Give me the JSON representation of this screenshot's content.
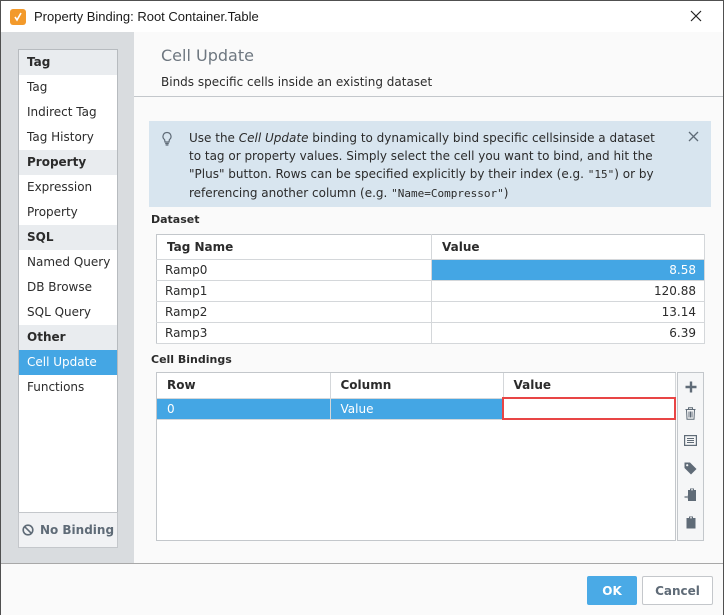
{
  "window": {
    "title": "Property Binding: Root Container.Table",
    "app_icon": "ignition-app-icon",
    "close_icon": "close-icon"
  },
  "sidebar": {
    "groups": [
      {
        "header": "Tag",
        "items": [
          {
            "label": "Tag"
          },
          {
            "label": "Indirect Tag"
          },
          {
            "label": "Tag History"
          }
        ]
      },
      {
        "header": "Property",
        "items": [
          {
            "label": "Expression"
          },
          {
            "label": "Property"
          }
        ]
      },
      {
        "header": "SQL",
        "items": [
          {
            "label": "Named Query"
          },
          {
            "label": "DB Browse"
          },
          {
            "label": "SQL Query"
          }
        ]
      },
      {
        "header": "Other",
        "items": [
          {
            "label": "Cell Update",
            "selected": true
          },
          {
            "label": "Functions"
          }
        ]
      }
    ],
    "no_binding_label": "No Binding",
    "no_binding_icon": "ban-icon"
  },
  "main": {
    "title": "Cell Update",
    "subtitle": "Binds specific cells inside an existing dataset",
    "info": {
      "icon": "lightbulb-icon",
      "text_prefix": "Use the ",
      "text_em": "Cell Update",
      "text_mid": " binding to dynamically bind specific cellsinside a dataset to tag or property values. Simply select the cell you want to bind, and hit the \"Plus\" button. Rows can be specified explicitly by their index (e.g. ",
      "text_mono1": "\"15\"",
      "text_mid2": ") or by referencing another column (e.g. ",
      "text_mono2": "\"Name=Compressor\"",
      "text_suffix": ")"
    },
    "dataset": {
      "label": "Dataset",
      "columns": [
        "Tag Name",
        "Value"
      ],
      "rows": [
        {
          "tag": "Ramp0",
          "value": "8.58",
          "selected": true
        },
        {
          "tag": "Ramp1",
          "value": "120.88"
        },
        {
          "tag": "Ramp2",
          "value": "13.14"
        },
        {
          "tag": "Ramp3",
          "value": "6.39"
        }
      ]
    },
    "cell_bindings": {
      "label": "Cell Bindings",
      "columns": [
        "Row",
        "Column",
        "Value"
      ],
      "rows": [
        {
          "row": "0",
          "column": "Value",
          "value": ""
        }
      ],
      "tools": [
        "add-icon",
        "delete-icon",
        "details-icon",
        "tag-icon",
        "paste-import-icon",
        "clipboard-icon"
      ]
    }
  },
  "footer": {
    "ok_label": "OK",
    "cancel_label": "Cancel"
  },
  "colors": {
    "accent": "#44a6e4",
    "edit_border": "#e84545",
    "info_bg": "#d8e5ef",
    "app_icon": "#f39a2b"
  }
}
